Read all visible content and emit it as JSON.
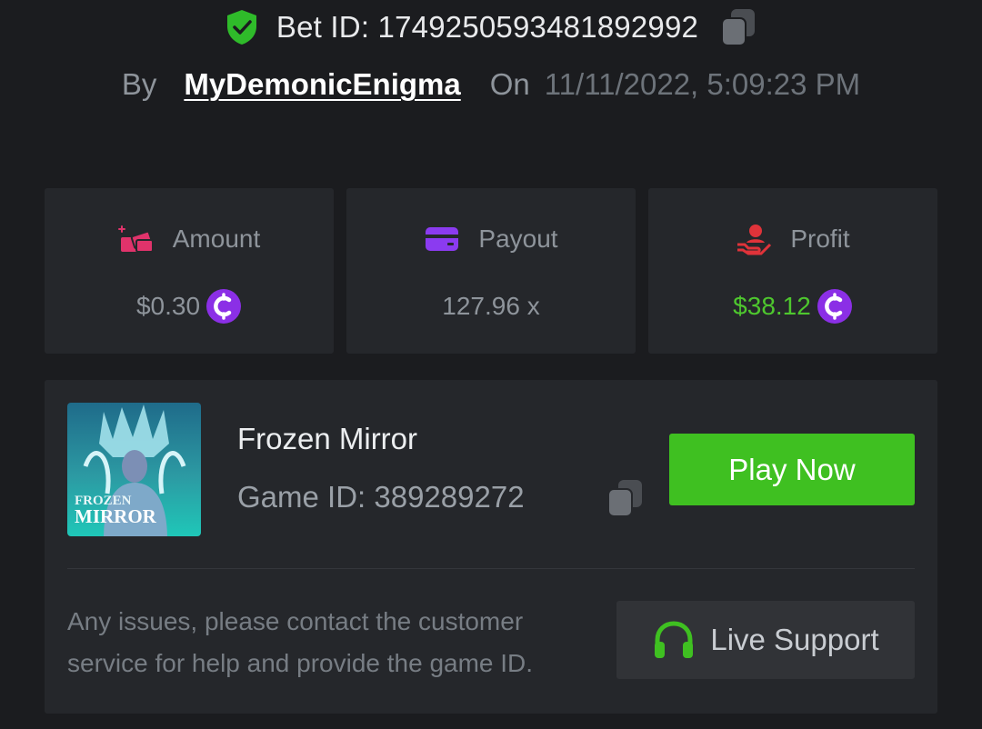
{
  "bet": {
    "id_label": "Bet ID: 1749250593481892992",
    "by_label": "By",
    "username": "MyDemonicEnigma",
    "on_label": "On",
    "timestamp": "11/11/2022, 5:09:23 PM"
  },
  "stats": [
    {
      "label": "Amount",
      "value": "$0.30",
      "icon": "money-stack-icon",
      "icon_color": "#e0336b",
      "value_color": "#8e949b",
      "coin": true
    },
    {
      "label": "Payout",
      "value": "127.96 x",
      "icon": "card-icon",
      "icon_color": "#8b3bf0",
      "value_color": "#8e949b",
      "coin": false
    },
    {
      "label": "Profit",
      "value": "$38.12",
      "icon": "hand-user-icon",
      "icon_color": "#e0333a",
      "value_color": "#4ec72e",
      "coin": true
    }
  ],
  "game": {
    "title": "Frozen Mirror",
    "id_label": "Game ID: 389289272",
    "thumb_text_1": "FROZEN",
    "thumb_text_2": "MIRROR",
    "play_label": "Play Now"
  },
  "support": {
    "notice": "Any issues, please contact the customer service for help and provide the game ID.",
    "button_label": "Live Support"
  },
  "colors": {
    "accent_green": "#3fc021",
    "shield_green": "#2fbb2a",
    "coin_purple": "#8b2fe6",
    "background": "#1b1c1f",
    "card": "#25272b"
  }
}
